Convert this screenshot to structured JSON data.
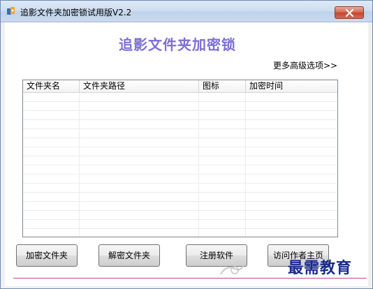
{
  "window": {
    "title": "追影文件夹加密锁试用版V2.2"
  },
  "main": {
    "heading": "追影文件夹加密锁",
    "more_options": "更多高级选项>>"
  },
  "table": {
    "columns": [
      "文件夹名",
      "文件夹路径",
      "图标",
      "加密时间"
    ],
    "rows": []
  },
  "buttons": {
    "encrypt": "加密文件夹",
    "decrypt": "解密文件夹",
    "register": "注册软件",
    "homepage": "访问作者主页"
  },
  "watermark": {
    "text": "最需教育"
  },
  "colors": {
    "heading": "#7b6fd6",
    "divider": "#c8448c",
    "watermark": "#1a2a8c"
  }
}
